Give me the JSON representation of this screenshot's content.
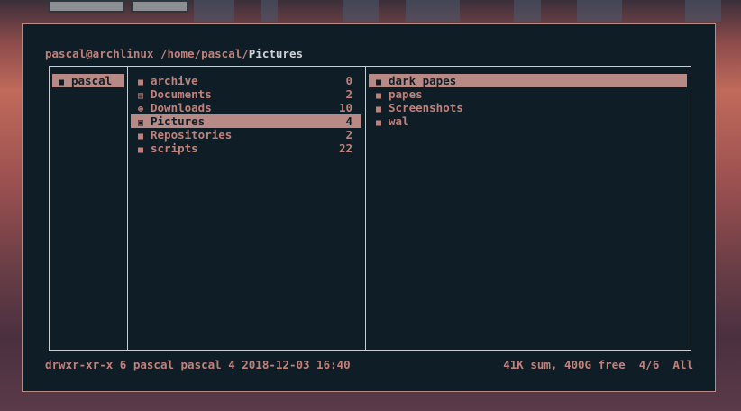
{
  "colors": {
    "background": "#0f1e26",
    "foreground": "#c0817b",
    "selection": "#b88a86",
    "border": "#c9ccd0",
    "current_dir": "#cfd3d6"
  },
  "title_bar": {
    "user_host": "pascal@archlinux",
    "path_prefix": "/home/pascal/",
    "current_dir": "Pictures"
  },
  "parent_pane": {
    "items": [
      {
        "name": "pascal",
        "icon": "folder-icon",
        "selected": true
      }
    ]
  },
  "current_pane": {
    "items": [
      {
        "name": "archive",
        "count": "0",
        "icon": "folder-icon"
      },
      {
        "name": "Documents",
        "count": "2",
        "icon": "document-icon"
      },
      {
        "name": "Downloads",
        "count": "10",
        "icon": "download-icon"
      },
      {
        "name": "Pictures",
        "count": "4",
        "icon": "image-icon",
        "selected": true
      },
      {
        "name": "Repositories",
        "count": "2",
        "icon": "folder-icon"
      },
      {
        "name": "scripts",
        "count": "22",
        "icon": "folder-icon"
      }
    ]
  },
  "preview_pane": {
    "items": [
      {
        "name": "dark papes",
        "icon": "folder-icon",
        "selected": true
      },
      {
        "name": "papes",
        "icon": "folder-icon"
      },
      {
        "name": "Screenshots",
        "icon": "folder-icon"
      },
      {
        "name": "wal",
        "icon": "folder-icon"
      }
    ]
  },
  "status_bar": {
    "permissions": "drwxr-xr-x",
    "info": "6 pascal pascal 4 2018-12-03 16:40",
    "disk": "41K sum, 400G free",
    "position": "4/6",
    "scroll": "All"
  }
}
